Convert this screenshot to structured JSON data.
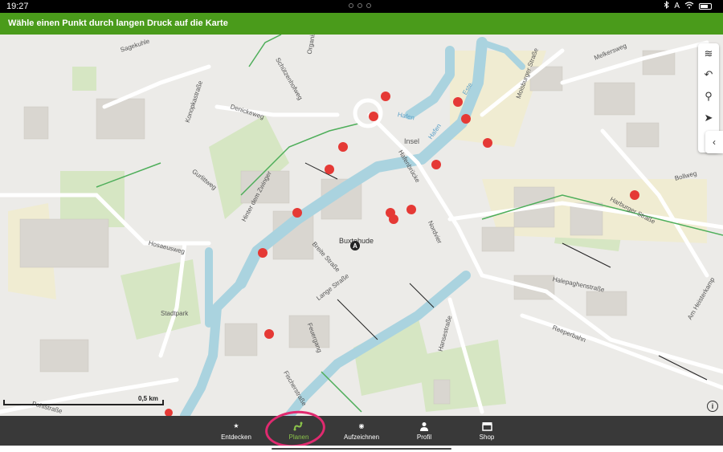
{
  "status": {
    "time": "19:27",
    "icons": [
      "bluetooth-icon",
      "a-icon",
      "wifi-icon",
      "battery-icon"
    ],
    "status_a": "A"
  },
  "banner": {
    "text": "Wähle einen Punkt durch langen Druck auf die Karte",
    "color": "#4a9b1b"
  },
  "map": {
    "streets": [
      "Sagekuhle",
      "Konopkastraße",
      "Denickeweg",
      "Gurlittweg",
      "Hinter dem Zwinger",
      "Hosaeusweg",
      "Breite Straße",
      "Lange Straße",
      "Fischerstraße",
      "Hafenbrücke",
      "Nordvier",
      "Halepaghenstraße",
      "Reeperbahn",
      "Hansestraße",
      "Feuergang",
      "Schützenhofweg",
      "Organist",
      "Moisburger Straße",
      "Melkersweg",
      "Bollweg",
      "Harburger Straße",
      "Am Heisterkamp",
      "Stadtpark",
      "Insel",
      "Buxtehude",
      "Pohlstraße",
      "Hafen",
      "Hafen",
      "Este"
    ],
    "town_marker": "A",
    "scale_label": "0,5 km"
  },
  "controls": [
    {
      "name": "layers-icon",
      "glyph": "≋"
    },
    {
      "name": "undo-icon",
      "glyph": "↶"
    },
    {
      "name": "search-icon",
      "glyph": "⚲"
    },
    {
      "name": "location-arrow-icon",
      "glyph": "➤"
    },
    {
      "name": "more-icon",
      "glyph": "⋮"
    }
  ],
  "collapse_glyph": "‹",
  "info_glyph": "i",
  "nav": [
    {
      "label": "Entdecken",
      "icon": "star-icon",
      "glyph": "★"
    },
    {
      "label": "Planen",
      "icon": "route-icon",
      "glyph": "⤴"
    },
    {
      "label": "Aufzeichnen",
      "icon": "record-icon",
      "glyph": "◉"
    },
    {
      "label": "Profil",
      "icon": "profile-icon",
      "glyph": "👤"
    },
    {
      "label": "Shop",
      "icon": "shop-icon",
      "glyph": "▦"
    }
  ],
  "colors": {
    "accent": "#8bc34a",
    "highlight": "#e02a6f",
    "nav_bg": "#393939",
    "poi": "#e53935",
    "water": "#aad3df"
  }
}
